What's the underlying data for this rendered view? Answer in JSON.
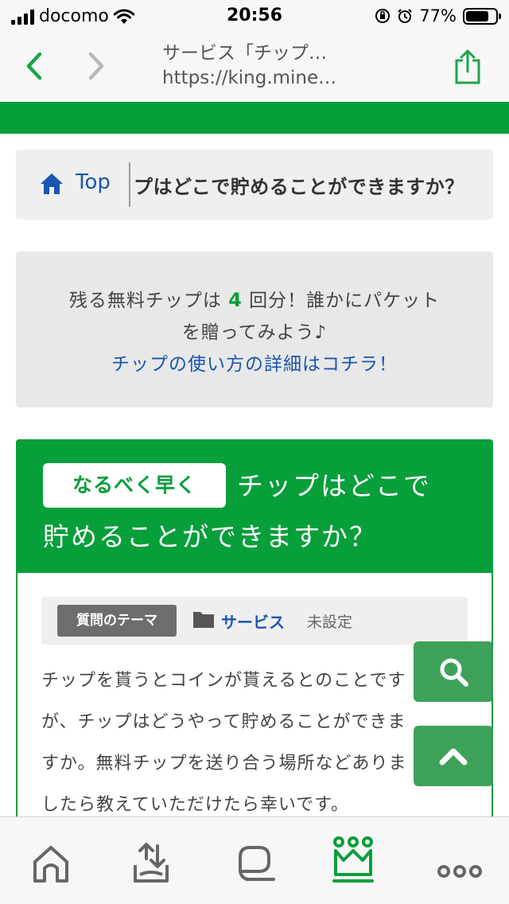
{
  "status_bar": {
    "carrier": "docomo",
    "time": "20:56",
    "battery": "77%"
  },
  "browser": {
    "page_title": "サービス「チップ…",
    "url": "https://king.mine…"
  },
  "breadcrumb": {
    "home_label": "Top",
    "current": "プはどこで貯めることができますか？"
  },
  "tip_box": {
    "line1_prefix": "残る無料チップは",
    "remaining_count": "4",
    "line1_suffix": "回分！誰かにパケット",
    "line2": "を贈ってみよう♪",
    "link": "チップの使い方の詳細はコチラ！"
  },
  "question": {
    "urgency_badge": "なるべく早く",
    "title_line1": "チップはどこで",
    "title_line2": "貯めることができますか？",
    "theme_label": "質問のテーマ",
    "category": "サービス",
    "subcategory": "未設定",
    "body_lines": [
      "チップを貰うとコインが貰えるとのことです",
      "が、チップはどうやって貯めることができま",
      "すか。無料チップを送り合う場所などありま",
      "したら教えていただけたら幸いです。"
    ]
  },
  "colors": {
    "brand_green": "#079f3a",
    "link_blue": "#1a56b0"
  },
  "icons": {
    "back": "chevron-left-icon",
    "forward": "chevron-right-icon",
    "share": "share-icon",
    "home": "home-icon",
    "folder": "folder-icon",
    "search": "search-icon",
    "scroll_top": "chevron-up-icon",
    "tabs": [
      "home-icon",
      "upload-icon",
      "chat-icon",
      "crown-icon",
      "more-icon"
    ]
  }
}
